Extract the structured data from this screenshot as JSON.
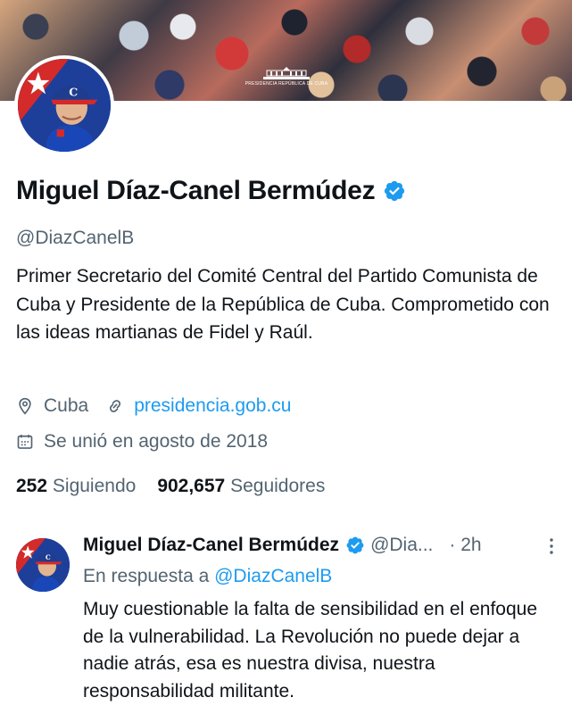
{
  "banner": {
    "caption": "PRESIDENCIA REPÚBLICA DE CUBA"
  },
  "profile": {
    "name": "Miguel Díaz-Canel Bermúdez",
    "handle": "@DiazCanelB",
    "bio": "Primer Secretario del Comité Central del Partido Comunista de Cuba y Presidente de la República de Cuba. Comprometido con las ideas martianas de Fidel y Raúl.",
    "location": "Cuba",
    "website": "presidencia.gob.cu",
    "joined": "Se unió en agosto de 2018",
    "following_count": "252",
    "following_label": "Siguiendo",
    "followers_count": "902,657",
    "followers_label": "Seguidores",
    "verified_color": "#1d9bf0"
  },
  "tweet": {
    "author": "Miguel Díaz-Canel Bermúdez",
    "handle": "@Dia...",
    "time": "· 2h",
    "reply_prefix": "En respuesta a",
    "reply_handle": "@DiazCanelB",
    "text": "Muy cuestionable la falta de sensibilidad en el enfoque de la vulnerabilidad. La Revolución no puede dejar a nadie atrás, esa es nuestra divisa, nuestra responsabilidad militante."
  },
  "icons": {
    "location": "location-pin-icon",
    "website": "link-icon",
    "joined": "calendar-icon",
    "verified": "verified-badge-icon",
    "more": "more-options-icon"
  }
}
